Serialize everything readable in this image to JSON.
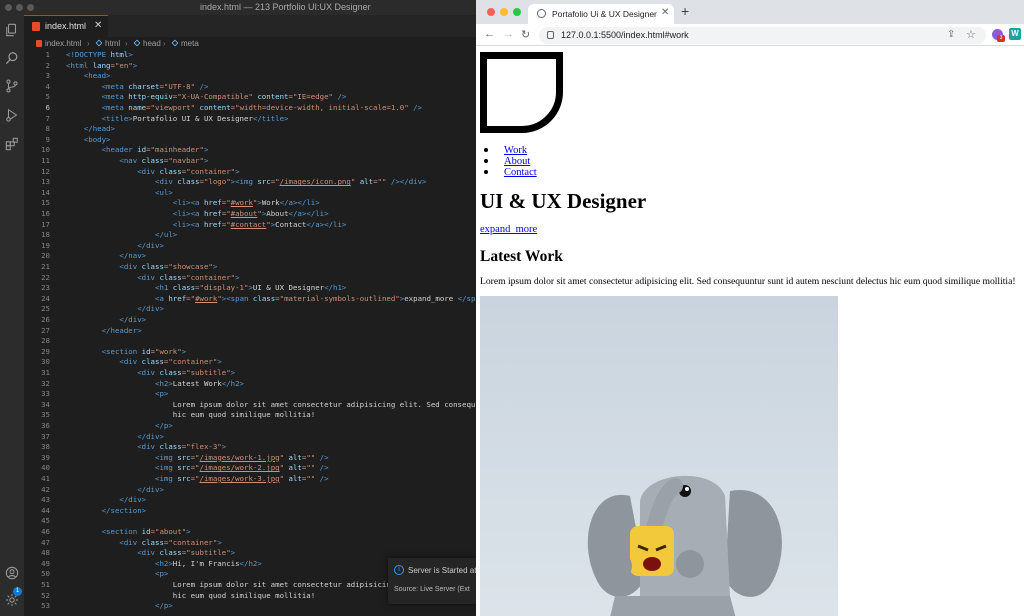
{
  "vscode": {
    "window_title": "index.html — 213 Portfolio UI:UX Designer",
    "tab": {
      "label": "index.html",
      "close": "✕"
    },
    "breadcrumb": [
      "index.html",
      "html",
      "head",
      "meta"
    ],
    "activity_badge": "1",
    "toast": {
      "message": "Server is Started at",
      "source": "Source: Live Server (Ext"
    },
    "active_line": 6
  },
  "browser": {
    "tab_title": "Portafolio Ui & UX Designer",
    "tab_close": "✕",
    "new_tab": "+",
    "url": "127.0.0.1:5500/index.html#work",
    "ext_badge": "3",
    "ext2_label": "W",
    "colors": {
      "close": "#ff5f57",
      "minimize": "#febc2e",
      "zoom": "#28c840"
    }
  },
  "page": {
    "nav": [
      "Work",
      "About",
      "Contact"
    ],
    "heading": "UI & UX Designer",
    "expand_link": "expand_more",
    "section_title": "Latest Work",
    "paragraph": "Lorem ipsum dolor sit amet consectetur adipisicing elit. Sed consequuntur sunt id autem nesciunt delectus hic eum quod similique mollitia!"
  }
}
